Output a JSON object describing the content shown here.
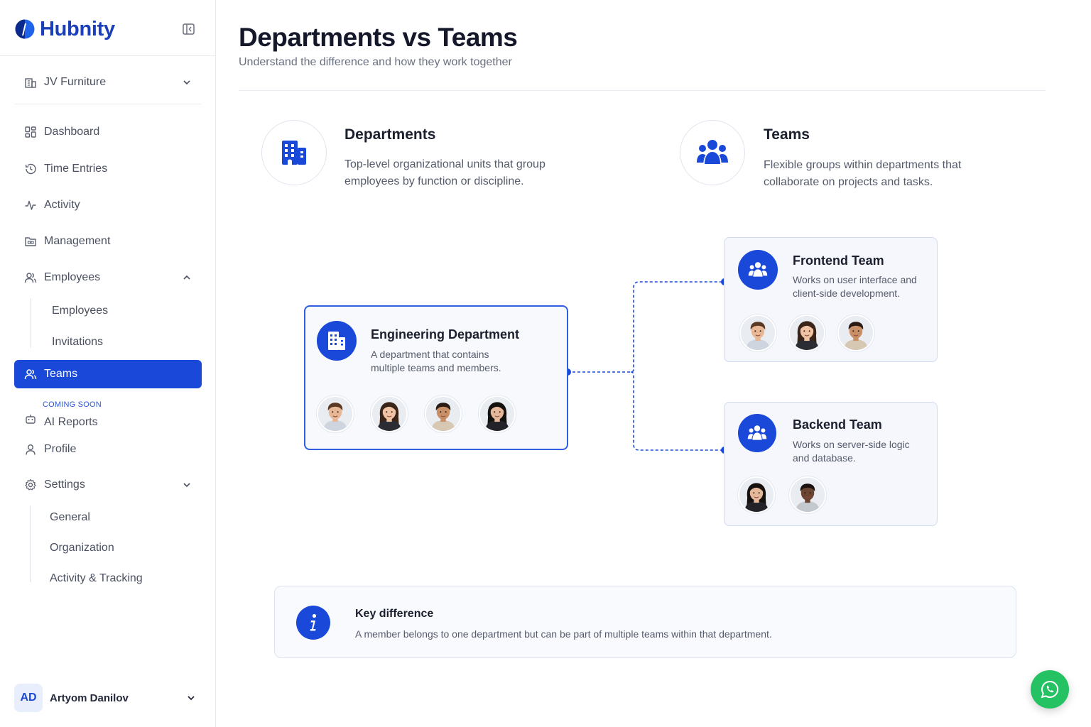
{
  "brand": {
    "name": "Hubnity"
  },
  "org_select": {
    "value": "JV Furniture"
  },
  "nav": {
    "dashboard": "Dashboard",
    "time_entries": "Time Entries",
    "activity": "Activity",
    "management": "Management",
    "employees": "Employees",
    "employees_sub": [
      "Employees",
      "Invitations"
    ],
    "teams": "Teams",
    "ai_reports_badge": "COMING SOON",
    "ai_reports": "AI Reports",
    "profile": "Profile",
    "settings": "Settings",
    "settings_sub": [
      "General",
      "Organization",
      "Activity & Tracking"
    ]
  },
  "user": {
    "initials": "AD",
    "name": "Artyom Danilov"
  },
  "page": {
    "title": "Departments vs Teams",
    "subtitle": "Understand the difference and how they work together"
  },
  "concepts": {
    "departments": {
      "title": "Departments",
      "description": "Top-level organizational units that group employees by function or discipline."
    },
    "teams": {
      "title": "Teams",
      "description": "Flexible groups within departments that collaborate on projects and tasks."
    }
  },
  "diagram": {
    "department": {
      "title": "Engineering Department",
      "description": "A department that contains multiple teams and members.",
      "member_count": 4
    },
    "frontend": {
      "title": "Frontend Team",
      "description": "Works on user interface and client-side development.",
      "member_count": 3
    },
    "backend": {
      "title": "Backend Team",
      "description": "Works on server-side logic and database.",
      "member_count": 2
    }
  },
  "key_difference": {
    "title": "Key difference",
    "text": "A member belongs to one department but can be part of multiple teams within that department."
  },
  "colors": {
    "primary": "#1a48d8",
    "brand_text": "#1b3fb8",
    "chat_fab": "#25c263"
  },
  "icons": {
    "departments": "building-icon",
    "teams": "users-group-icon",
    "info": "info-icon",
    "chat": "whatsapp-icon"
  }
}
